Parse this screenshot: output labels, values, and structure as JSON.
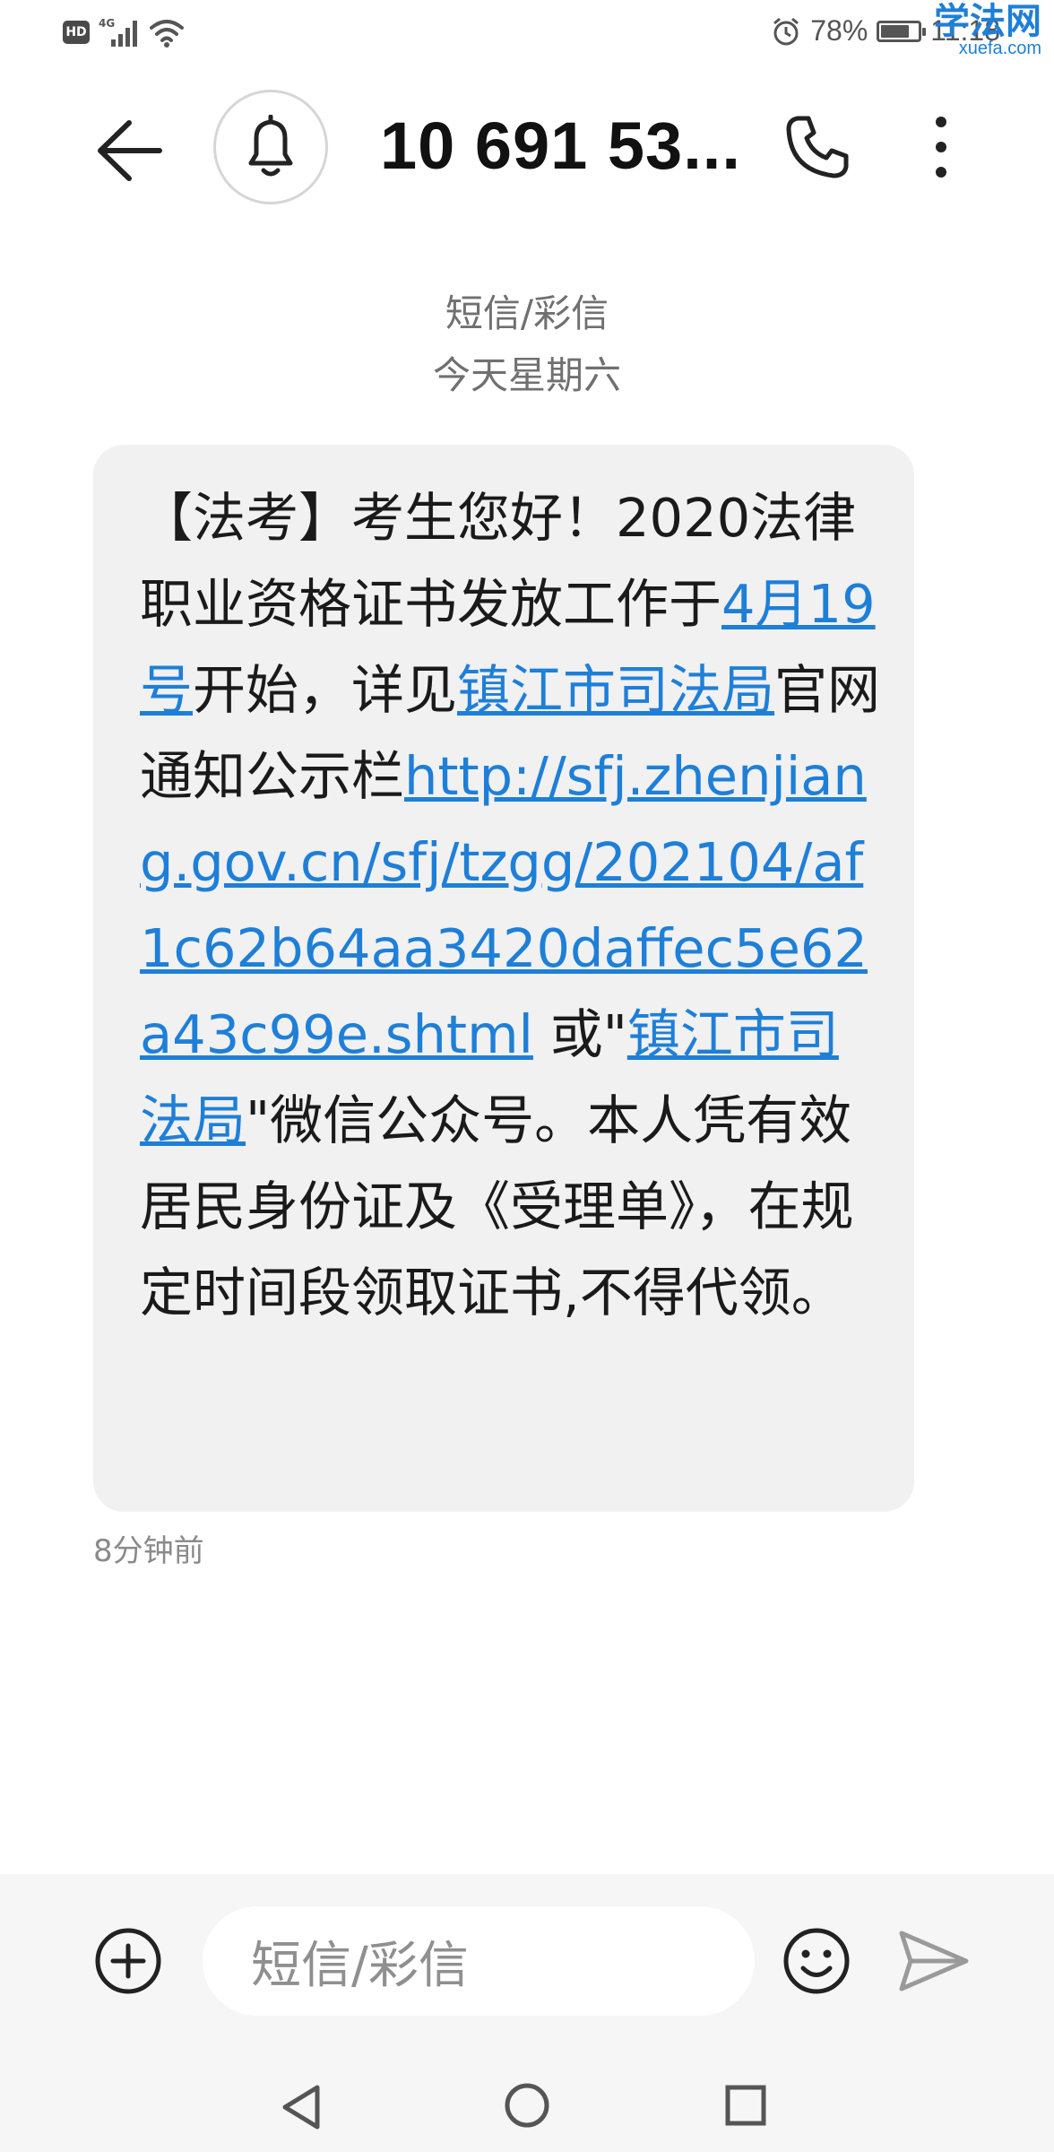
{
  "status_bar": {
    "hd_label": "HD",
    "network_label": "4G",
    "battery_percent": "78%",
    "battery_level": 0.78,
    "time": "11:18"
  },
  "watermark": {
    "main": "学法网",
    "sub": "xuefa.com"
  },
  "header": {
    "title": "10 691 53..."
  },
  "meta": {
    "channel": "短信/彩信",
    "date": "今天星期六"
  },
  "message": {
    "segments": [
      {
        "text": "【法考】考生您好！2020法律职业资格证书发放工作于",
        "link": false
      },
      {
        "text": "4月19号",
        "link": true
      },
      {
        "text": "开始，详见",
        "link": false
      },
      {
        "text": "镇江市司法局",
        "link": true
      },
      {
        "text": "官网通知公示栏",
        "link": false
      },
      {
        "text": "http://sfj.zhenjiang.gov.cn/sfj/tzgg/202104/af1c62b64aa3420daffec5e62a43c99e.shtml",
        "link": true
      },
      {
        "text": " 或\"",
        "link": false
      },
      {
        "text": "镇江市司法局",
        "link": true
      },
      {
        "text": "\"微信公众号。本人凭有效居民身份证及《受理单》，在规定时间段领取证书,不得代领。",
        "link": false
      }
    ],
    "time": "8分钟前"
  },
  "input": {
    "placeholder": "短信/彩信"
  },
  "colors": {
    "link": "#1e7fd8",
    "bubble": "#f1f1f1",
    "accent": "#1e7fd8"
  },
  "icons": [
    "hd-icon",
    "signal-icon",
    "wifi-icon",
    "alarm-icon",
    "battery-icon",
    "back-arrow-icon",
    "bell-icon",
    "phone-icon",
    "more-vert-icon",
    "add-circle-icon",
    "emoji-icon",
    "send-icon",
    "nav-back-icon",
    "nav-home-icon",
    "nav-recent-icon"
  ]
}
